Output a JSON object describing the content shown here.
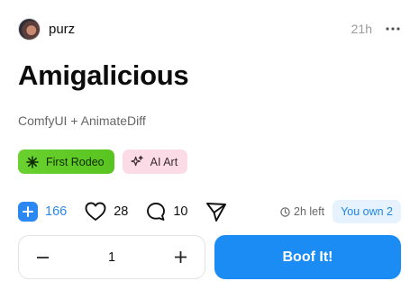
{
  "post": {
    "username": "purz",
    "time_ago": "21h",
    "title": "Amigalicious",
    "subtitle": "ComfyUI + AnimateDiff",
    "tags": [
      {
        "label": "First Rodeo",
        "icon": "sparkle-star-icon",
        "color": "#5fcb24"
      },
      {
        "label": "AI Art",
        "icon": "sparkles-icon",
        "color": "#fbdbe5"
      }
    ]
  },
  "actions": {
    "upvotes": "166",
    "likes": "28",
    "comments": "10",
    "time_left": "2h left",
    "ownership": "You own 2"
  },
  "purchase": {
    "quantity": "1",
    "buy_label": "Boof It!"
  },
  "colors": {
    "accent": "#1a8cf4",
    "own_badge_bg": "#e6f2fd"
  }
}
